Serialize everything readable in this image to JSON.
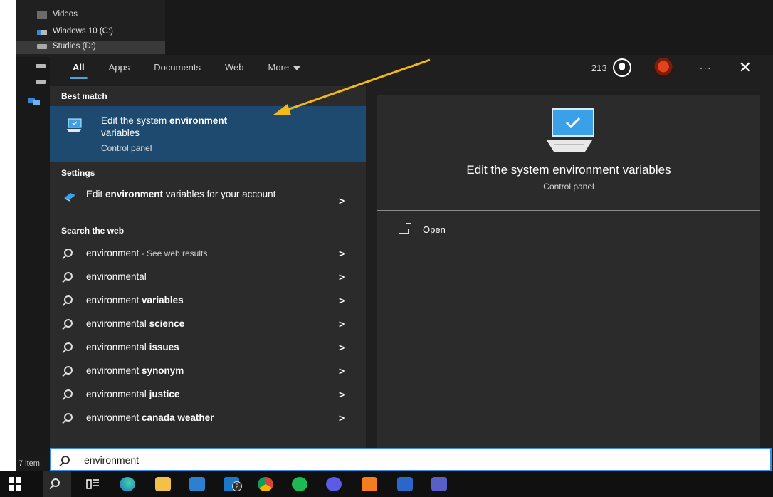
{
  "explorer": {
    "items": [
      {
        "label": "Videos",
        "icon": "video-folder-icon"
      },
      {
        "label": "Windows 10 (C:)",
        "icon": "drive-icon"
      },
      {
        "label": "Studies (D:)",
        "icon": "drive-icon"
      }
    ],
    "status_count": "7 item"
  },
  "search": {
    "tabs": [
      {
        "label": "All",
        "active": true
      },
      {
        "label": "Apps"
      },
      {
        "label": "Documents"
      },
      {
        "label": "Web"
      },
      {
        "label": "More"
      }
    ],
    "points": "213",
    "more_label": "···",
    "close_label": "✕",
    "best_match_label": "Best match",
    "best_match": {
      "title_pre": "Edit the system ",
      "title_bold": "environment",
      "title_post": "variables",
      "subtitle": "Control panel"
    },
    "settings_label": "Settings",
    "settings_item": {
      "pre": "Edit ",
      "bold": "environment",
      "post": " variables for your account"
    },
    "web_label": "Search the web",
    "web_results": [
      {
        "base": "environment",
        "bold": "",
        "sub": " - See web results"
      },
      {
        "base": "environmental",
        "bold": "",
        "sub": ""
      },
      {
        "base": "environment ",
        "bold": "variables",
        "sub": ""
      },
      {
        "base": "environmental ",
        "bold": "science",
        "sub": ""
      },
      {
        "base": "environmental ",
        "bold": "issues",
        "sub": ""
      },
      {
        "base": "environment ",
        "bold": "synonym",
        "sub": ""
      },
      {
        "base": "environmental ",
        "bold": "justice",
        "sub": ""
      },
      {
        "base": "environment ",
        "bold": "canada weather",
        "sub": ""
      }
    ],
    "chevron": ">",
    "preview": {
      "title": "Edit the system environment variables",
      "subtitle": "Control panel",
      "open_label": "Open"
    },
    "query": "environment"
  },
  "taskbar": {
    "mail_badge": "2"
  },
  "colors": {
    "accent": "#4aa3df",
    "selected": "#1e4a70",
    "arrow": "#f5b915"
  }
}
